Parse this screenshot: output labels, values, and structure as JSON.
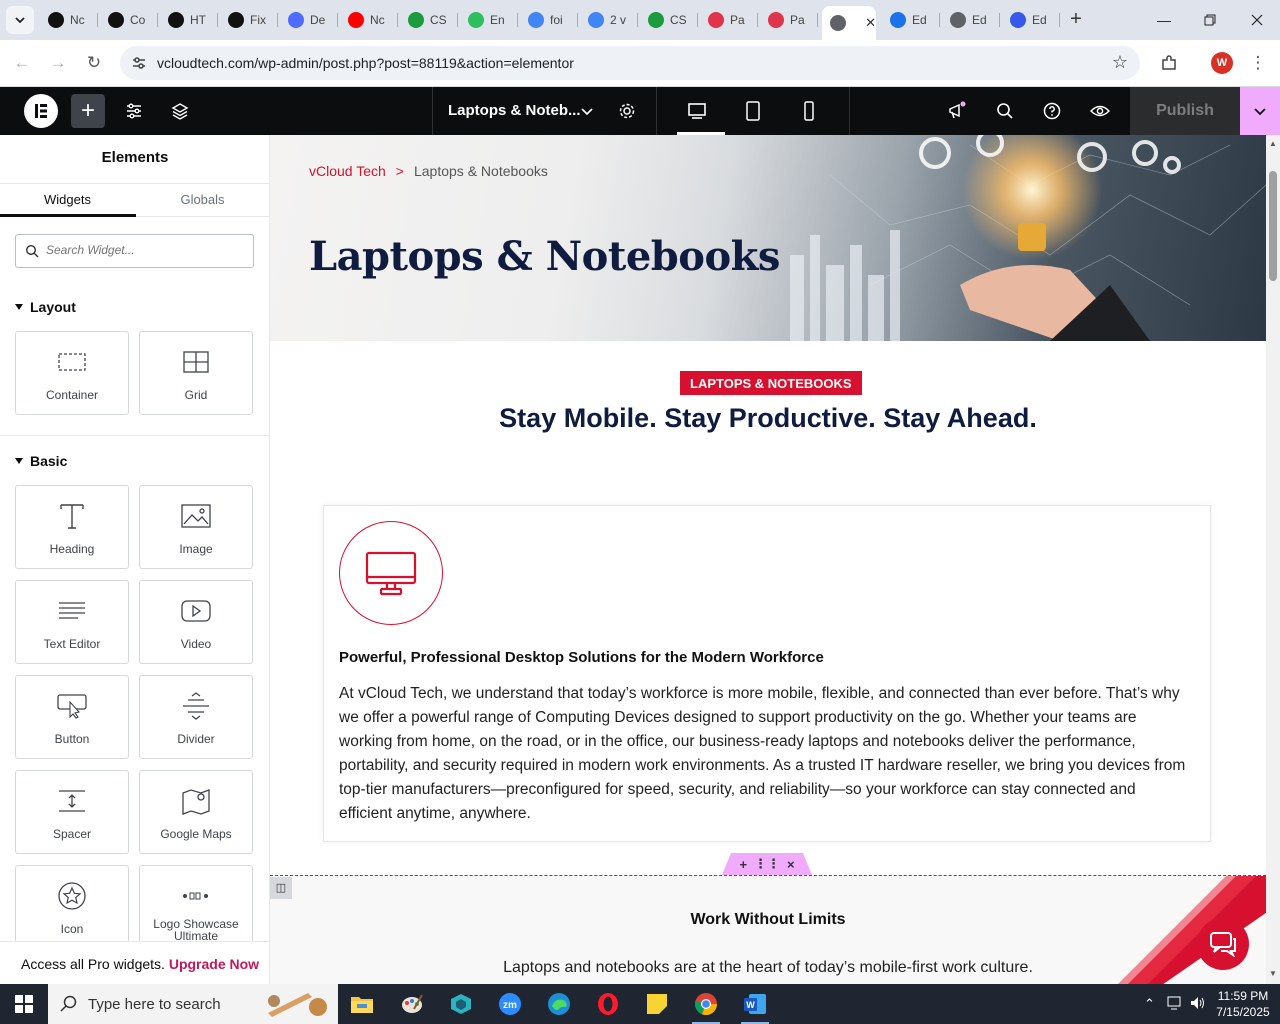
{
  "browser": {
    "tabs": [
      {
        "label": "Nc",
        "icon": "openai-icon",
        "color": "#111111"
      },
      {
        "label": "Co",
        "icon": "openai-icon",
        "color": "#111111"
      },
      {
        "label": "HT",
        "icon": "openai-icon",
        "color": "#111111"
      },
      {
        "label": "Fix",
        "icon": "openai-icon",
        "color": "#111111"
      },
      {
        "label": "De",
        "icon": "deepseek-icon",
        "color": "#4d6bfe"
      },
      {
        "label": "Nc",
        "icon": "youtube-icon",
        "color": "#ff0000"
      },
      {
        "label": "CS",
        "icon": "w-icon",
        "color": "#1a9c3e"
      },
      {
        "label": "En",
        "icon": "evernote-icon",
        "color": "#2dbe60"
      },
      {
        "label": "foi",
        "icon": "google-icon",
        "color": "#4285f4"
      },
      {
        "label": "2 v",
        "icon": "google-icon",
        "color": "#4285f4"
      },
      {
        "label": "CS",
        "icon": "w-icon",
        "color": "#1a9c3e"
      },
      {
        "label": "Pa",
        "icon": "diamond-icon",
        "color": "#e0334c"
      },
      {
        "label": "Pa",
        "icon": "diamond-icon",
        "color": "#e0334c"
      },
      {
        "label": "",
        "icon": "globe-icon",
        "color": "#5f6368",
        "active": true
      },
      {
        "label": "Ed",
        "icon": "edit-icon",
        "color": "#1a73e8"
      },
      {
        "label": "Ed",
        "icon": "globe-icon",
        "color": "#5f6368"
      },
      {
        "label": "Ed",
        "icon": "wp-icon",
        "color": "#3858e9"
      }
    ],
    "url": "vcloudtech.com/wp-admin/post.php?post=88119&action=elementor",
    "profile_initial": "W"
  },
  "elementor": {
    "page_title": "Laptops & Noteb...",
    "publish_label": "Publish"
  },
  "panel": {
    "title": "Elements",
    "tabs": [
      "Widgets",
      "Globals"
    ],
    "search_placeholder": "Search Widget...",
    "sections": {
      "layout": "Layout",
      "basic": "Basic"
    },
    "layout_widgets": [
      "Container",
      "Grid"
    ],
    "basic_widgets": [
      "Heading",
      "Image",
      "Text Editor",
      "Video",
      "Button",
      "Divider",
      "Spacer",
      "Google Maps",
      "Icon",
      "Logo Showcase Ultimate"
    ],
    "pro_text": "Access all Pro widgets.",
    "pro_link": "Upgrade Now"
  },
  "canvas": {
    "breadcrumb": {
      "home": "vCloud Tech",
      "separator": ">",
      "current": "Laptops & Notebooks"
    },
    "hero_title": "Laptops & Notebooks",
    "badge": "LAPTOPS & NOTEBOOKS",
    "tagline": "Stay Mobile. Stay Productive. Stay Ahead.",
    "card": {
      "heading": "Powerful, Professional Desktop Solutions for the Modern Workforce",
      "body": "At vCloud Tech, we understand that today’s workforce is more mobile, flexible, and connected than ever before. That’s why we offer a powerful range of Computing Devices designed to support productivity on the go. Whether your teams are working from home, on the road, or in the office, our business-ready laptops and notebooks deliver the performance, portability, and security required in modern work environments. As a trusted IT hardware reseller, we bring you devices from top-tier manufacturers—preconfigured for speed, security, and reliability—so your workforce can stay connected and efficient anytime, anywhere."
    },
    "section2": {
      "title": "Work Without Limits",
      "body": "Laptops and notebooks are at the heart of today’s mobile-first work culture."
    }
  },
  "taskbar": {
    "search_placeholder": "Type here to search",
    "time": "11:59 PM",
    "date": "7/15/2025"
  },
  "colors": {
    "accent_red": "#d6102e",
    "navy": "#0f1c3f",
    "elementor_pink": "#f0abfc"
  }
}
